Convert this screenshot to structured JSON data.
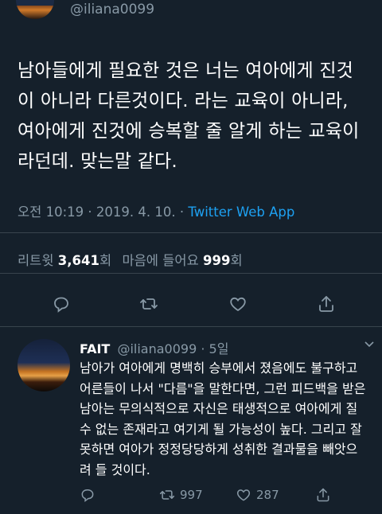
{
  "top_tweet": {
    "handle": "@iliana0099",
    "text": "남아들에게 필요한 것은 너는 여아에게 진것이 아니라 다른것이다. 라는 교육이 아니라, 여아에게 진것에 승복할 줄 알게 하는 교육이라던데. 맞는말 같다.",
    "time": "오전 10:19",
    "sep1": " · ",
    "date": "2019. 4. 10.",
    "sep2": " · ",
    "via": "Twitter Web App",
    "retweets_label": "리트윗",
    "retweets": "3,641",
    "retweets_unit": "회",
    "likes_label": "마음에 들어요",
    "likes": "999",
    "likes_unit": "회"
  },
  "reply": {
    "name": "FAIT",
    "handle": "@iliana0099",
    "sep": " · ",
    "age": "5일",
    "text": "남아가 여아에게 명백히 승부에서 졌음에도 불구하고 어른들이 나서 \"다름\"을 말한다면, 그런 피드백을 받은 남아는 무의식적으로 자신은 태생적으로 여아에게 질 수 없는 존재라고 여기게 될 가능성이 높다. 그리고 잘못하면 여아가 정정당당하게 성취한 결과물을 빼앗으려 들 것이다.",
    "retweets": "997",
    "likes": "287"
  },
  "colors": {
    "background": "#15202b",
    "muted": "#8899a6",
    "accent": "#1da1f2",
    "divider": "#38444d"
  },
  "icons": [
    "reply-icon",
    "retweet-icon",
    "heart-icon",
    "share-icon",
    "chevron-down-icon"
  ]
}
